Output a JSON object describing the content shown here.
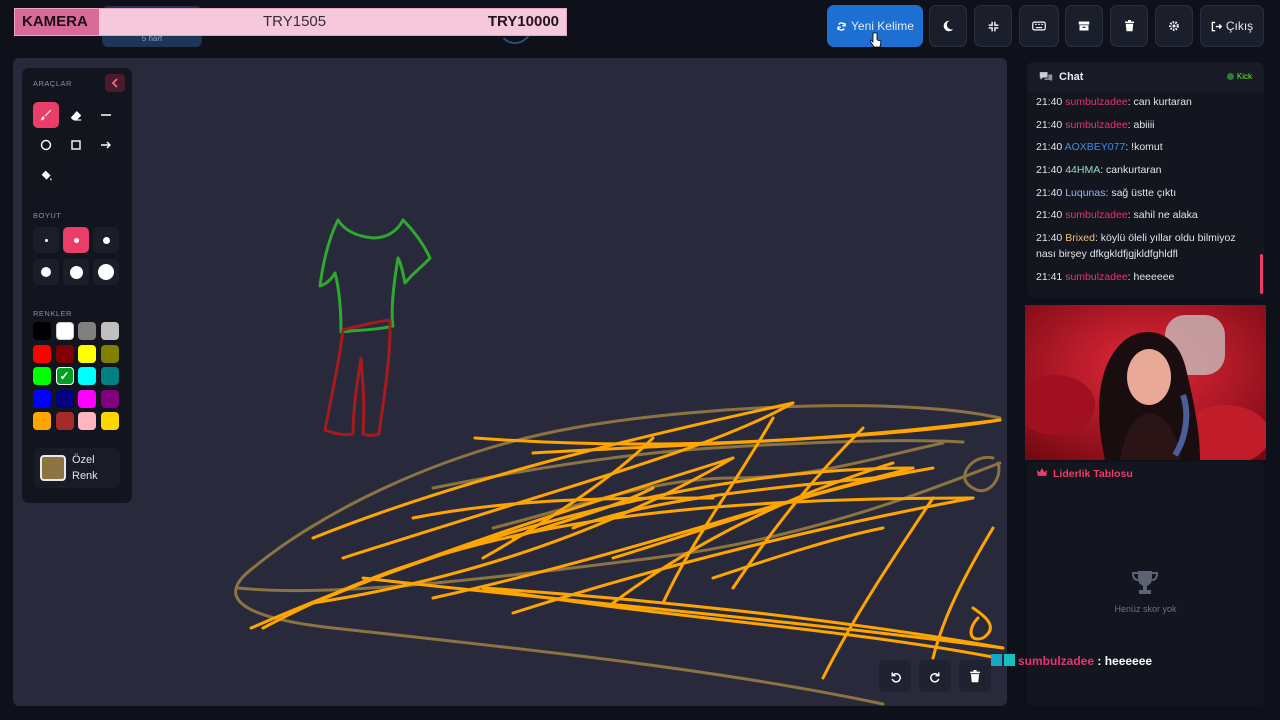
{
  "overlay_banner": {
    "left": "KAMERA",
    "middle": "TRY1505",
    "right": "TRY10000"
  },
  "word_chip": {
    "hint": "5 harf"
  },
  "toolbar": {
    "new_word_label": "Yeni Kelime",
    "logout_label": "Çıkış",
    "icons": [
      "refresh-icon",
      "moon-icon",
      "compress-icon",
      "keyboard-icon",
      "archive-icon",
      "trash-icon",
      "gear-icon",
      "logout-icon"
    ]
  },
  "tools_panel": {
    "tools_title": "ARAÇLAR",
    "size_title": "BOYUT",
    "colors_title": "RENKLER",
    "custom_color_label": "Özel Renk",
    "custom_color": "#8b7441",
    "active_tool": "brush",
    "active_size": "medium",
    "selected_color": "#00a020",
    "colors": [
      "#000000",
      "#ffffff",
      "#808080",
      "#c0c0c0",
      "#ff0000",
      "#800000",
      "#ffff00",
      "#808000",
      "#00ff00",
      "#00a020",
      "#00ffff",
      "#008080",
      "#0000ff",
      "#000080",
      "#ff00ff",
      "#800080",
      "#ffa500",
      "#a52a2a",
      "#ffb6c1",
      "#ffd700"
    ]
  },
  "chat": {
    "title": "Chat",
    "platform": "Kick",
    "messages": [
      {
        "time": "21:40",
        "user": "sumbulzadee",
        "color": "#e8356e",
        "text": ": can kurtaran"
      },
      {
        "time": "21:40",
        "user": "sumbulzadee",
        "color": "#e8356e",
        "text": ": abiiii"
      },
      {
        "time": "21:40",
        "user": "AOXBEY077",
        "color": "#3d8fe8",
        "text": ": !komut"
      },
      {
        "time": "21:40",
        "user": "44HMA",
        "color": "#8fe0b4",
        "text": ": cankurtaran"
      },
      {
        "time": "21:40",
        "user": "Luqunas",
        "color": "#8fb8ff",
        "text": ": sağ üstte çıktı"
      },
      {
        "time": "21:40",
        "user": "sumbulzadee",
        "color": "#e8356e",
        "text": ": sahil ne alaka"
      },
      {
        "time": "21:40",
        "user": "Brixed",
        "color": "#f2c27a",
        "text": ": köylü öleli yıllar oldu bilmiyoz nası birşey dfkgkldfjgjkldfghldfl"
      },
      {
        "time": "21:41",
        "user": "sumbulzadee",
        "color": "#e8356e",
        "text": ": heeeeee"
      }
    ]
  },
  "leaderboard": {
    "title": "Liderlik Tablosu",
    "empty_text": "Henüz skor yok"
  },
  "stream_overlay": {
    "user": "sumbulzadee",
    "separator": " : ",
    "text": "heeeeee"
  }
}
